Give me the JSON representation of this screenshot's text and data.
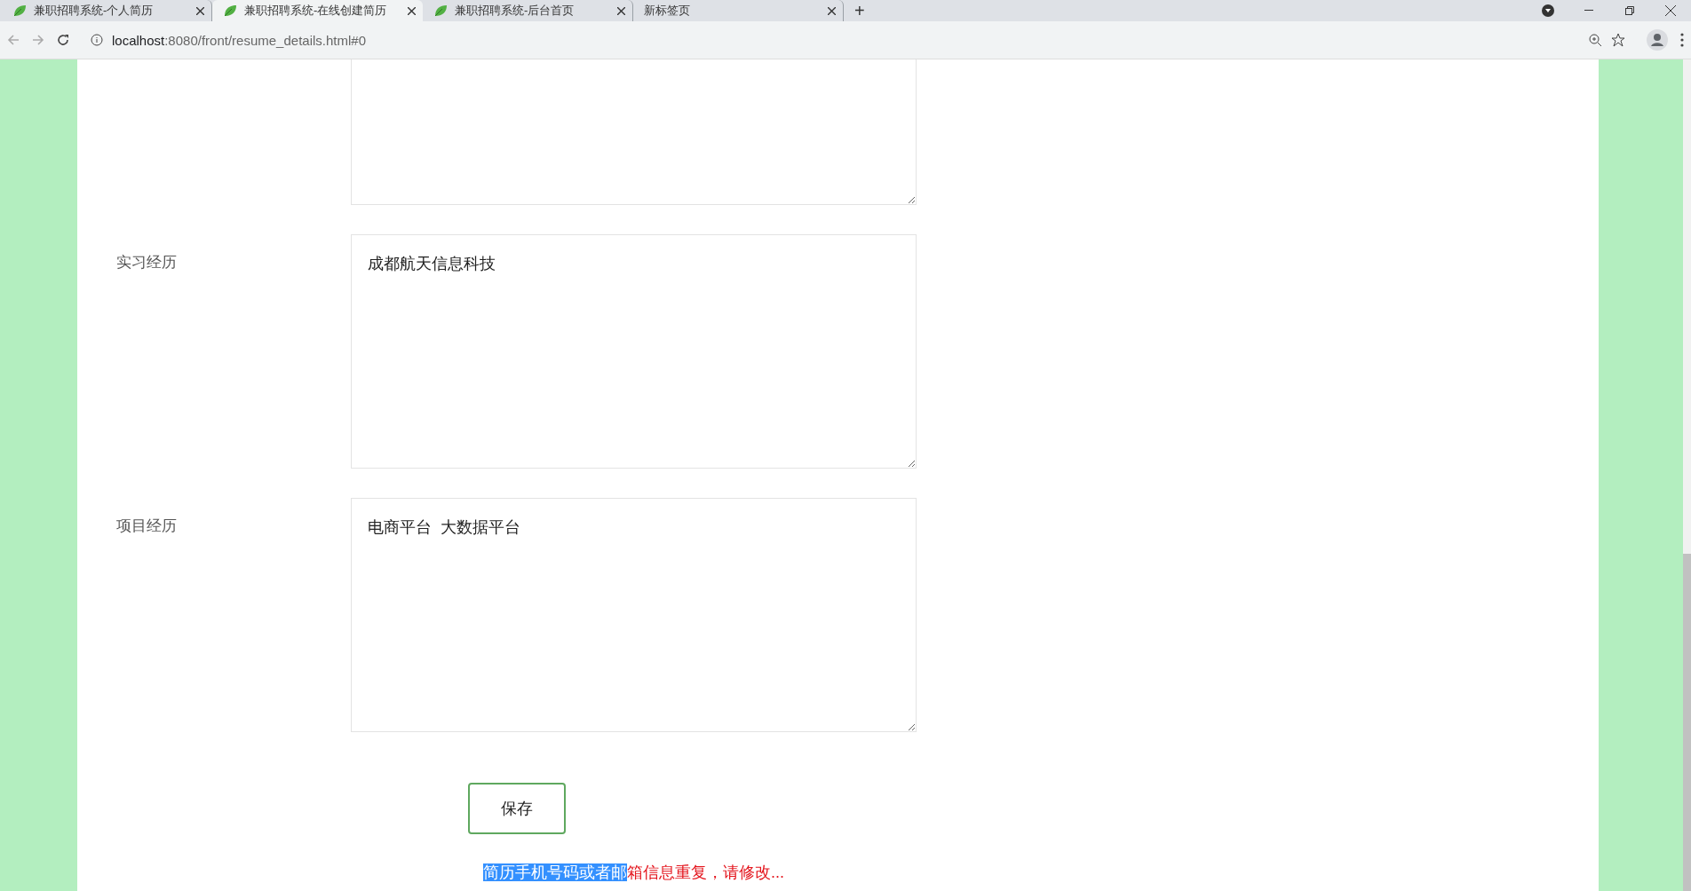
{
  "browser": {
    "tabs": [
      {
        "title": "兼职招聘系统-个人简历",
        "selected": false,
        "favicon": true
      },
      {
        "title": "兼职招聘系统-在线创建简历",
        "selected": true,
        "favicon": true
      },
      {
        "title": "兼职招聘系统-后台首页",
        "selected": false,
        "favicon": true
      },
      {
        "title": "新标签页",
        "selected": false,
        "favicon": false
      }
    ],
    "new_tab": "+",
    "address": {
      "host": "localhost",
      "rest": ":8080/front/resume_details.html#0"
    }
  },
  "form": {
    "fields": [
      {
        "label": "实习经历",
        "value": "成都航天信息科技"
      },
      {
        "label": "项目经历",
        "value": "电商平台  大数据平台"
      }
    ],
    "save_button": "保存",
    "message": [
      {
        "text": "简历手机号码或者邮",
        "selected": true
      },
      {
        "text": "箱信息重复，请修改...",
        "selected": false
      }
    ]
  }
}
